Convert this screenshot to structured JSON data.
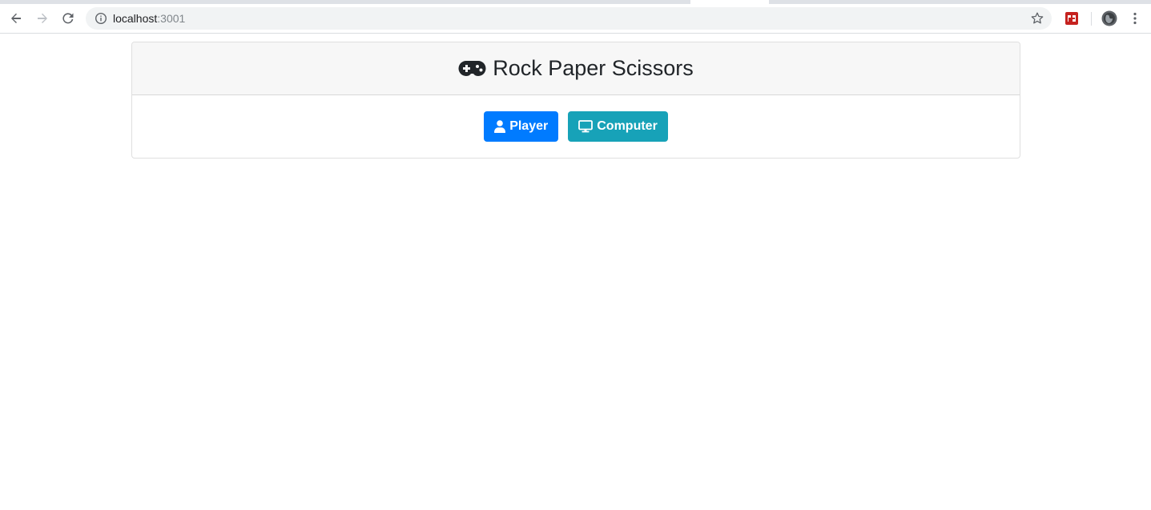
{
  "browser": {
    "url_host": "localhost",
    "url_port": ":3001"
  },
  "game": {
    "title": "Rock Paper Scissors",
    "buttons": [
      {
        "label": "Player",
        "icon": "user-icon",
        "color": "#007bff"
      },
      {
        "label": "Computer",
        "icon": "desktop-icon",
        "color": "#17a2b8"
      }
    ]
  }
}
